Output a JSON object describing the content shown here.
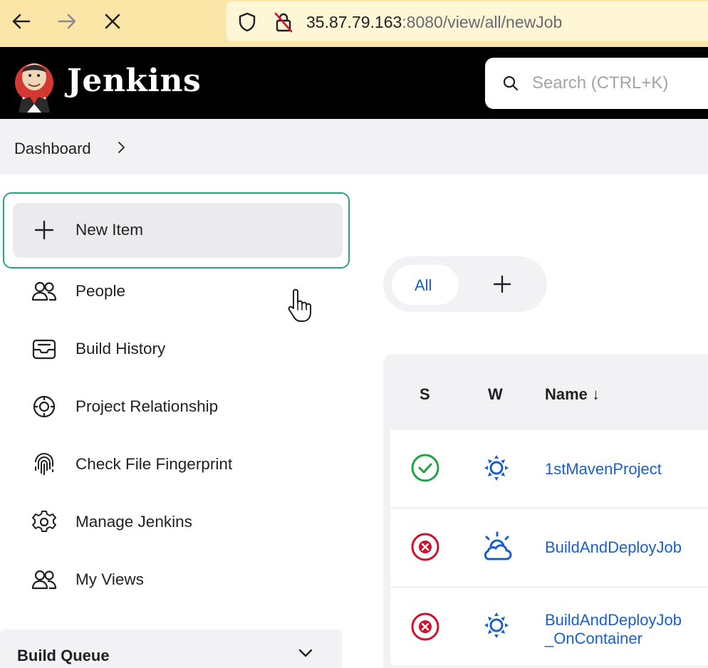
{
  "browser": {
    "url_host": "35.87.79.163",
    "url_path": ":8080/view/all/newJob",
    "back_icon": "arrow-left-icon",
    "forward_icon": "arrow-right-icon",
    "stop_icon": "close-icon"
  },
  "header": {
    "brand": "Jenkins",
    "search_placeholder": "Search (CTRL+K)"
  },
  "breadcrumb": {
    "items": [
      "Dashboard"
    ]
  },
  "sidebar": {
    "items": [
      {
        "label": "New Item",
        "icon": "plus-icon"
      },
      {
        "label": "People",
        "icon": "people-icon"
      },
      {
        "label": "Build History",
        "icon": "inbox-icon"
      },
      {
        "label": "Project Relationship",
        "icon": "relationship-icon"
      },
      {
        "label": "Check File Fingerprint",
        "icon": "fingerprint-icon"
      },
      {
        "label": "Manage Jenkins",
        "icon": "gear-icon"
      },
      {
        "label": "My Views",
        "icon": "people-icon"
      }
    ],
    "build_queue": "Build Queue"
  },
  "views": {
    "tabs": [
      "All"
    ],
    "add_icon": "plus-icon"
  },
  "table": {
    "headers": {
      "status": "S",
      "weather": "W",
      "name": "Name",
      "sort_indicator": "↓"
    },
    "rows": [
      {
        "status": "success",
        "weather": "sunny",
        "name_lines": [
          "1stMavenProject",
          ""
        ]
      },
      {
        "status": "failed",
        "weather": "cloudy",
        "name_lines": [
          "BuildAndDeployJob",
          ""
        ]
      },
      {
        "status": "failed",
        "weather": "sunny",
        "name_lines": [
          "BuildAndDeployJob",
          "_OnContainer"
        ]
      }
    ]
  },
  "colors": {
    "accent_link": "#1a5fc9",
    "success": "#1ea446",
    "failure": "#d2102a",
    "focus_outline": "#2aa382",
    "browser_bar": "#fbe6a8"
  }
}
